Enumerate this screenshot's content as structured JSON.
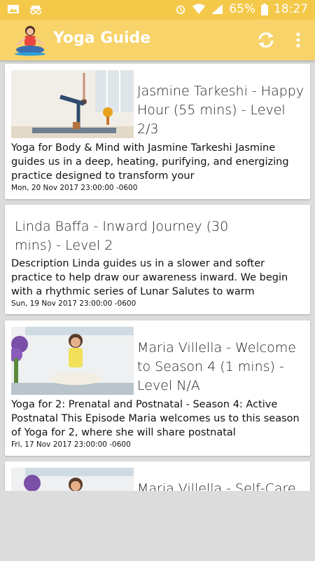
{
  "status": {
    "battery": "65%",
    "time": "18:27"
  },
  "app": {
    "title": "Yoga Guide"
  },
  "icons": {
    "gallery": "image-icon",
    "incognito": "spy-icon",
    "alarm": "alarm-icon",
    "wifi": "wifi-icon",
    "signal": "signal-icon",
    "battery": "battery-icon",
    "refresh": "refresh-icon",
    "more": "more-vert-icon"
  },
  "colors": {
    "statusbar": "#f4c94a",
    "appbar": "#f7d36a"
  },
  "items": [
    {
      "title": "Jasmine Tarkeshi - Happy Hour (55 mins) - Level 2/3",
      "desc": "Yoga for Body & Mind with Jasmine Tarkeshi Jasmine guides us in a deep, heating, purifying, and energizing practice designed to transform your",
      "date": "Mon, 20 Nov 2017 23:00:00 -0600"
    },
    {
      "title": "Linda Baffa - Inward Journey (30 mins) - Level 2",
      "desc": "Description  Linda guides us in a slower and softer practice to help draw our awareness inward. We begin with a rhythmic series of Lunar Salutes to warm",
      "date": "Sun, 19 Nov 2017 23:00:00 -0600"
    },
    {
      "title": "Maria Villella - Welcome to Season 4 (1 mins) - Level N/A",
      "desc": "Yoga for 2: Prenatal and Postnatal - Season 4: Active Postnatal  This Episode  Maria welcomes us to this season of Yoga for 2, where she will share postnatal",
      "date": "Fri, 17 Nov 2017 23:00:00 -0600"
    },
    {
      "title": "Maria Villella - Self-Care"
    }
  ]
}
